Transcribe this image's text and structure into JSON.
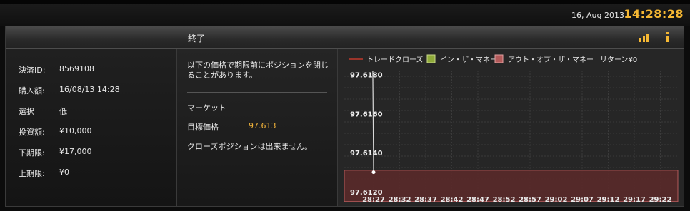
{
  "header": {
    "date": "16, Aug 2013",
    "time": "14:28:28"
  },
  "panel": {
    "title": "終了",
    "icons": [
      "signal-bars-icon",
      "info-icon"
    ]
  },
  "details": [
    {
      "label": "決済ID:",
      "value": "8569108"
    },
    {
      "label": "購入額:",
      "value": "16/08/13 14:28"
    },
    {
      "label": "選択",
      "value": "低"
    },
    {
      "label": "投資額:",
      "value": "¥10,000"
    },
    {
      "label": "下期限:",
      "value": "¥17,000"
    },
    {
      "label": "上期限:",
      "value": "¥0"
    }
  ],
  "info": {
    "notice": "以下の価格で期限前にポジションを閉じることがあります。",
    "market_label": "マーケット",
    "target_label": "目標価格",
    "target_value": "97.613",
    "cannot_close": "クローズポジションは出来ません。"
  },
  "legend": {
    "trade_close": "トレードクローズ",
    "in_the_money": "イン・ザ・マネー",
    "out_of_the_money": "アウト・オブ・ザ・マネー",
    "return": "リターン¥0"
  },
  "colors": {
    "accent": "#f6b833",
    "trade_line": "#c0392b",
    "in_the_money": "#8faa3a",
    "out_of_the_money": "#b35a5a",
    "price_line": "#d9d9d9"
  },
  "chart_data": {
    "type": "line",
    "x": [
      "28:27",
      "28:32",
      "28:37",
      "28:42",
      "28:47",
      "28:52",
      "28:57",
      "29:02",
      "29:07",
      "29:12",
      "29:17",
      "29:22"
    ],
    "y_ticks": [
      "97.6180",
      "97.6160",
      "97.6140",
      "97.6120"
    ],
    "ylim": [
      97.612,
      97.6182
    ],
    "series": [
      {
        "points": [
          {
            "x": "28:18",
            "y": 97.6182
          },
          {
            "x": "28:27",
            "y": 97.613
          }
        ]
      }
    ],
    "out_of_the_money_band": [
      97.6115,
      97.6131
    ],
    "grid": true
  }
}
